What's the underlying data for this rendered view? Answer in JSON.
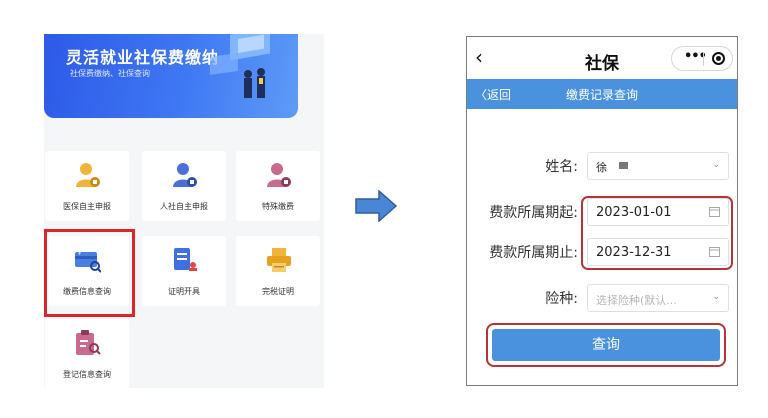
{
  "left_app": {
    "banner": {
      "title": "灵活就业社保费缴纳",
      "subtitle": "社保费缴纳、社保查询"
    },
    "tiles": [
      {
        "label": "医保自主申报"
      },
      {
        "label": "人社自主申报"
      },
      {
        "label": "特殊缴费"
      },
      {
        "label": "缴费信息查询"
      },
      {
        "label": "证明开具"
      },
      {
        "label": "完税证明"
      },
      {
        "label": "登记信息查询"
      }
    ],
    "highlighted_tile": "缴费信息查询"
  },
  "phone": {
    "top_title": "社保",
    "nav": {
      "back_label": "返回",
      "title": "缴费记录查询"
    },
    "form": {
      "name_label": "姓名:",
      "name_value": "徐",
      "start_label": "费款所属期起:",
      "start_value": "2023-01-01",
      "end_label": "费款所属期止:",
      "end_value": "2023-12-31",
      "type_label": "险种:",
      "type_placeholder": "选择险种(默认..."
    },
    "query_label": "查询"
  },
  "colors": {
    "accent_blue": "#4a92de",
    "highlight_red": "#d9252b"
  }
}
